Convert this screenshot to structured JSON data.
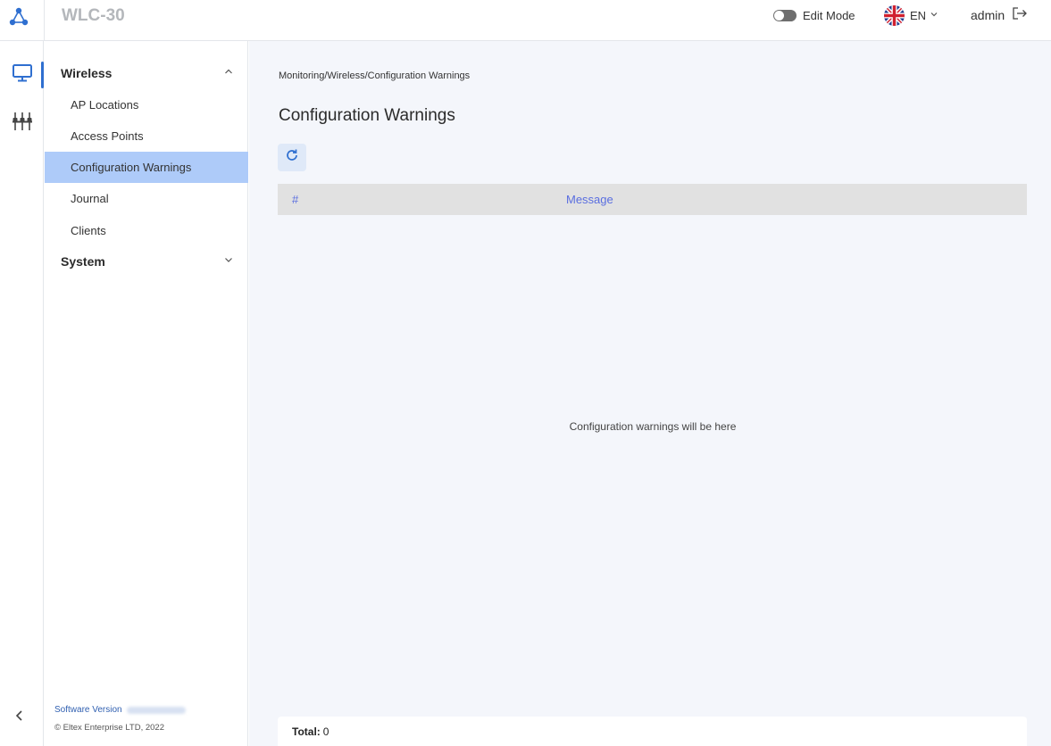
{
  "header": {
    "title": "WLC-30",
    "edit_mode_label": "Edit Mode",
    "language": "EN",
    "user": "admin"
  },
  "rail": {
    "items": [
      {
        "icon": "monitor-icon",
        "active": true
      },
      {
        "icon": "settings-sliders-icon",
        "active": false
      }
    ]
  },
  "sidebar": {
    "groups": [
      {
        "label": "Wireless",
        "expanded": true,
        "items": [
          {
            "label": "AP Locations"
          },
          {
            "label": "Access Points"
          },
          {
            "label": "Configuration Warnings",
            "active": true
          },
          {
            "label": "Journal"
          },
          {
            "label": "Clients"
          }
        ]
      },
      {
        "label": "System",
        "expanded": false
      }
    ],
    "software_version_label": "Software Version",
    "copyright": "© Eltex Enterprise LTD, 2022"
  },
  "main": {
    "breadcrumb": "Monitoring/Wireless/Configuration Warnings",
    "title": "Configuration Warnings",
    "table": {
      "columns": [
        "#",
        "Message"
      ],
      "rows": []
    },
    "empty_message": "Configuration warnings will be here",
    "total_label": "Total:",
    "total_value": "0"
  },
  "colors": {
    "accent": "#2f6fd0",
    "active_nav_bg": "#aecbf9",
    "column_header_text": "#5a6ee0",
    "main_bg": "#f4f6fb"
  }
}
